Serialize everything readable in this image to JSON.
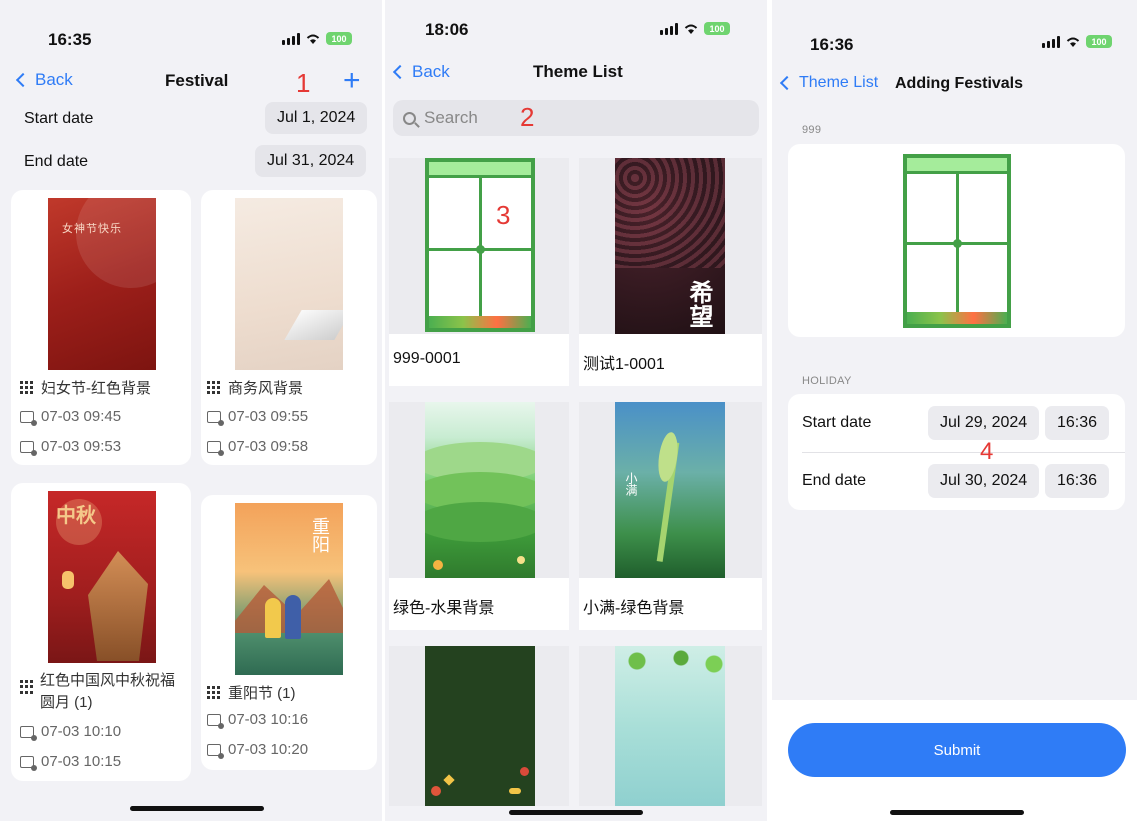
{
  "screen1": {
    "time": "16:35",
    "battery": "100",
    "back_label": "Back",
    "title": "Festival",
    "annotation": "1",
    "add_symbol": "+",
    "start_label": "Start date",
    "start_value": "Jul 1, 2024",
    "end_label": "End date",
    "end_value": "Jul 31, 2024",
    "cards": [
      {
        "name": "妇女节-红色背景",
        "t1": "07-03 09:45",
        "t2": "07-03 09:53",
        "thumb_text": "女神节快乐"
      },
      {
        "name": "商务风背景",
        "t1": "07-03 09:55",
        "t2": "07-03 09:58"
      },
      {
        "name": "红色中国风中秋祝福圆月 (1)",
        "t1": "07-03 10:10",
        "t2": "07-03 10:15",
        "thumb_text": "中秋"
      },
      {
        "name": "重阳节 (1)",
        "t1": "07-03 10:16",
        "t2": "07-03 10:20",
        "thumb_text": "重阳"
      }
    ]
  },
  "screen2": {
    "time": "18:06",
    "battery": "100",
    "back_label": "Back",
    "title": "Theme List",
    "search_placeholder": "Search",
    "annotation_search": "2",
    "annotation_theme": "3",
    "themes": [
      {
        "label": "999-0001"
      },
      {
        "label": "测试1-0001",
        "thumb_text": "希望"
      },
      {
        "label": "绿色-水果背景"
      },
      {
        "label": "小满-绿色背景",
        "thumb_text": "小满"
      },
      {
        "label": ""
      },
      {
        "label": ""
      }
    ]
  },
  "screen3": {
    "time": "16:36",
    "battery": "100",
    "back_label": "Theme List",
    "title": "Adding Festivals",
    "theme_section": "999",
    "holiday_section": "HOLIDAY",
    "start_label": "Start date",
    "start_date": "Jul 29, 2024",
    "start_time": "16:36",
    "end_label": "End date",
    "end_date": "Jul 30, 2024",
    "end_time": "16:36",
    "annotation": "4",
    "submit_label": "Submit"
  },
  "colors": {
    "accent": "#2f7cf6",
    "annotation": "#e53935",
    "theme_green": "#43a047",
    "battery": "#6fd46f"
  }
}
